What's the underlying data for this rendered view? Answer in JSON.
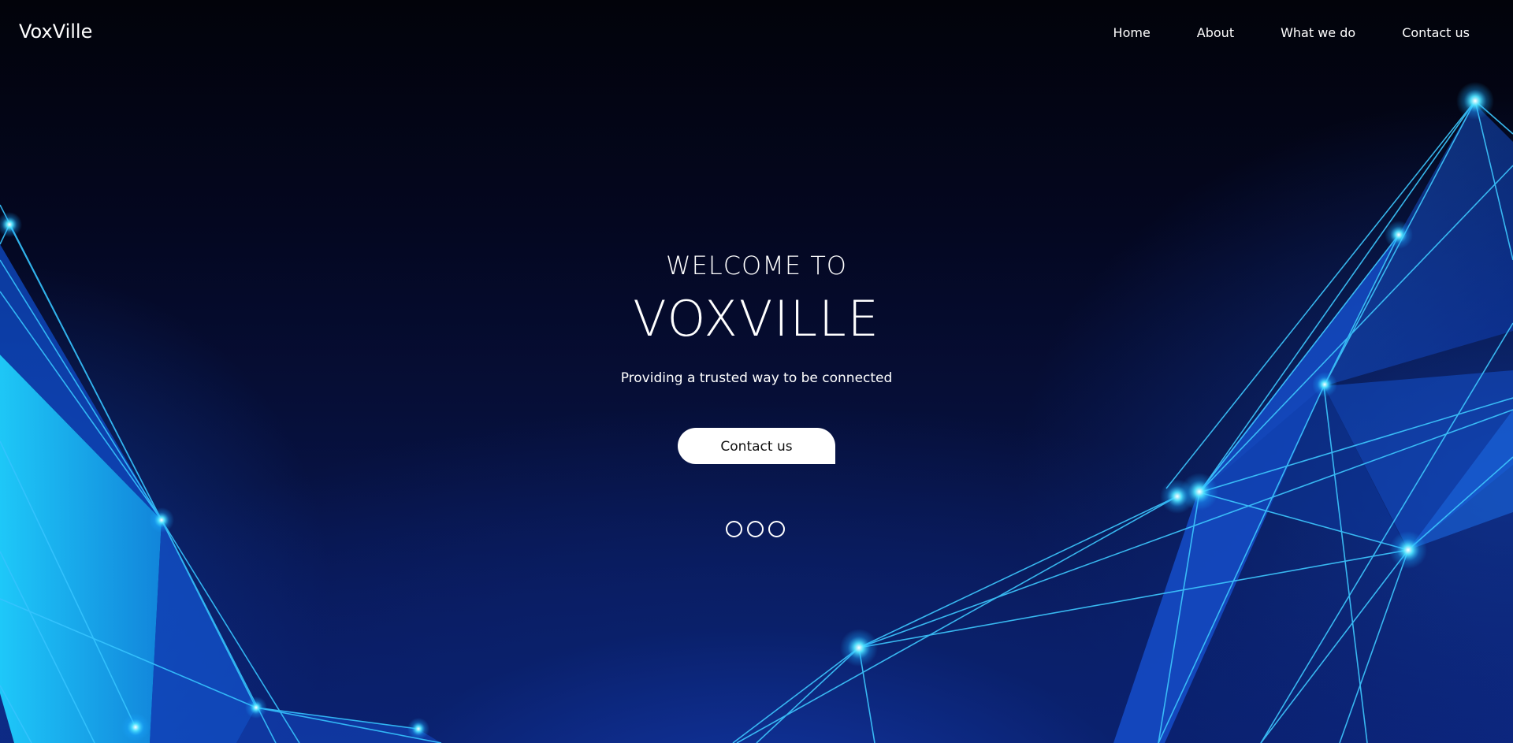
{
  "brand": {
    "name": "VoxVille"
  },
  "nav": {
    "items": [
      {
        "label": "Home"
      },
      {
        "label": "About"
      },
      {
        "label": "What we do"
      },
      {
        "label": "Contact us"
      }
    ]
  },
  "hero": {
    "kicker": "WELCOME TO",
    "title": "VOXVILLE",
    "tagline": "Providing a trusted way to be connected",
    "cta_label": "Contact us",
    "slide_count": 3
  },
  "colors": {
    "background": "#03040d",
    "accent_glow": "#22d3ff",
    "network_line": "#2fb8ff",
    "button_bg": "#ffffff",
    "text": "#ffffff"
  },
  "background_image": {
    "icon": "network-mesh-graphic"
  }
}
